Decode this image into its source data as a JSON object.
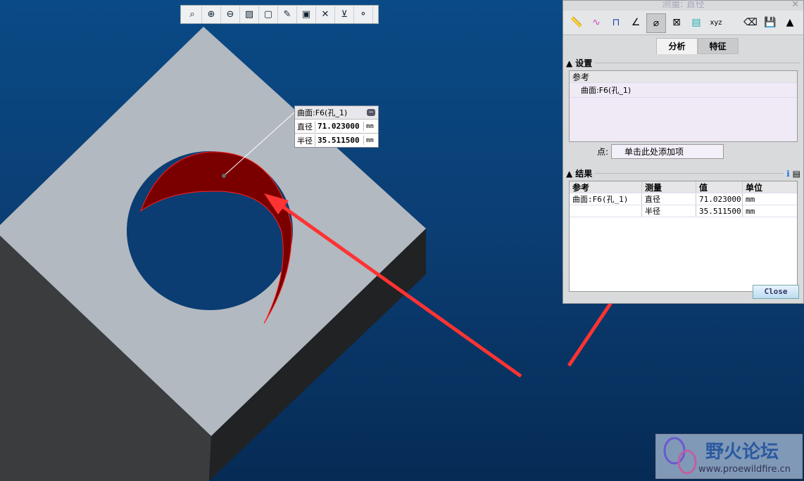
{
  "toolbar": {
    "icons": [
      "zoom-window-icon",
      "zoom-in-icon",
      "zoom-out-icon",
      "refit-icon",
      "view-style-icon",
      "annotation-icon",
      "snapshot-icon",
      "datum-icon",
      "spin-center-icon",
      "network-icon"
    ]
  },
  "tag": {
    "title": "曲面:F6(孔_1)",
    "rows": [
      {
        "label": "直径",
        "value": "71.023000",
        "unit": "mm"
      },
      {
        "label": "半径",
        "value": "35.511500",
        "unit": "mm"
      }
    ]
  },
  "panel": {
    "title": "测量: 直径",
    "close_x": "✕",
    "tabs": [
      "分析",
      "特征"
    ],
    "settings_label": "设置",
    "ref_header": "参考",
    "ref_item": "曲面:F6(孔_1)",
    "point_label": "点:",
    "point_placeholder": "单击此处添加项",
    "results_label": "结果",
    "table": {
      "headers": [
        "参考",
        "测量",
        "值",
        "单位"
      ],
      "rows": [
        [
          "曲面:F6(孔_1)",
          "直径",
          "71.023000",
          "mm"
        ],
        [
          "",
          "半径",
          "35.511500",
          "mm"
        ]
      ]
    },
    "close_label": "Close"
  },
  "watermark": {
    "title": "野火论坛",
    "url": "www.proewildfire.cn"
  },
  "colors": {
    "background": "#0b3d72",
    "face": "#b0b8c0",
    "highlight": "#cc0000",
    "arrow": "#ff3333"
  }
}
